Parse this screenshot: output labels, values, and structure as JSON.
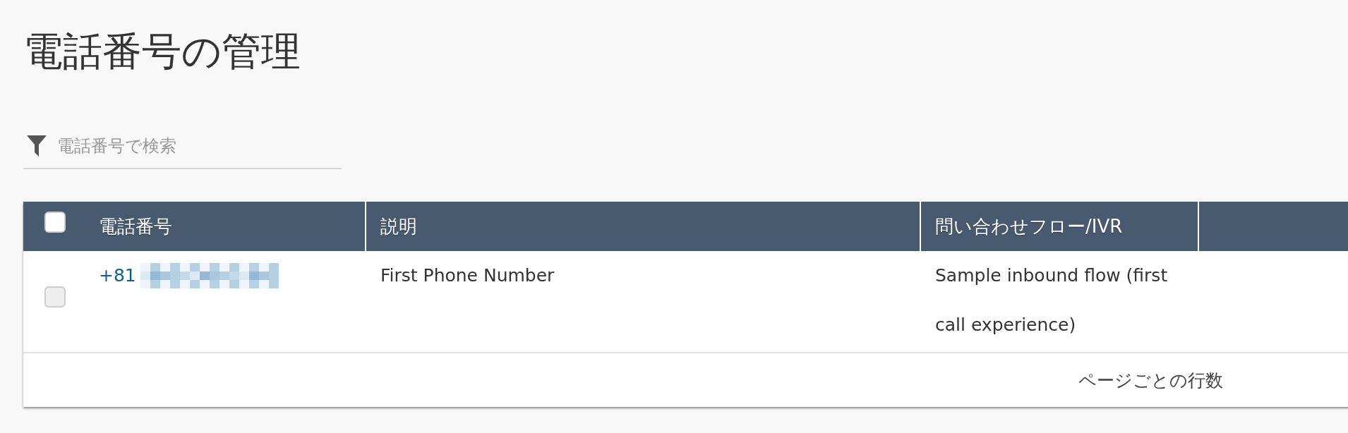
{
  "title": "電話番号の管理",
  "search": {
    "placeholder": "電話番号で検索"
  },
  "table": {
    "select_all": {
      "checked": false
    },
    "columns": [
      "電話番号",
      "説明",
      "問い合わせフロー/IVR"
    ],
    "rows": [
      {
        "checked": false,
        "phone": "+81",
        "description": "First Phone Number",
        "flow": "Sample inbound flow (first call experience)"
      }
    ],
    "footer": "ページごとの行数"
  }
}
